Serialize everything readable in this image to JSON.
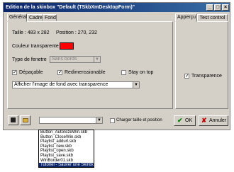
{
  "window": {
    "title": "Edition de la skinbox \"Default (TSkbXmDesktopForm)\"",
    "minimize_glyph": "_",
    "maximize_glyph": "□",
    "close_glyph": "×"
  },
  "tabs_left": [
    {
      "label": "Général",
      "active": true
    },
    {
      "label": "Cadre",
      "active": false
    },
    {
      "label": "Fond",
      "active": false
    }
  ],
  "tabs_right": [
    {
      "label": "Apperçu",
      "active": true
    },
    {
      "label": "Test control",
      "active": false
    }
  ],
  "general": {
    "size_label": "Taille : 483 x 282",
    "position_label": "Position : 270, 232",
    "transparent_color_label": "Couleur transparente",
    "transparent_color": "#ff0000",
    "window_type_label": "Type de fenetre",
    "window_type_value": "Sans bords",
    "draggable_label": "Dépaçable",
    "draggable_checked": "✓",
    "resizable_label": "Redimenssionable",
    "resizable_checked": "✓",
    "stay_on_top_label": "Stay on top",
    "background_mode_value": "Afficher l'image de fond avec transparence"
  },
  "preview": {
    "transparency_label": "Transparence",
    "transparency_checked": "✓"
  },
  "bottom": {
    "skin_combo_value": "",
    "load_size_pos_label": "Charger taille et position",
    "ok_label": "OK",
    "ok_glyph": "✔",
    "cancel_label": "Annuler",
    "cancel_glyph": "✘",
    "colors": {
      "ok_green": "#008000",
      "cancel_red": "#c00000",
      "selection": "#0a246a"
    }
  },
  "dropdown_items": [
    "Button_AutoSizeWin.skb",
    "Button_CloseWin.skb",
    "Playlist_addurl.skb",
    "Playlist_new.skb",
    "Playlist_open.skb",
    "Playlist_save.skb",
    "WinBorder01.skb",
    "Tutoriel - Sauver une SkinBox"
  ]
}
